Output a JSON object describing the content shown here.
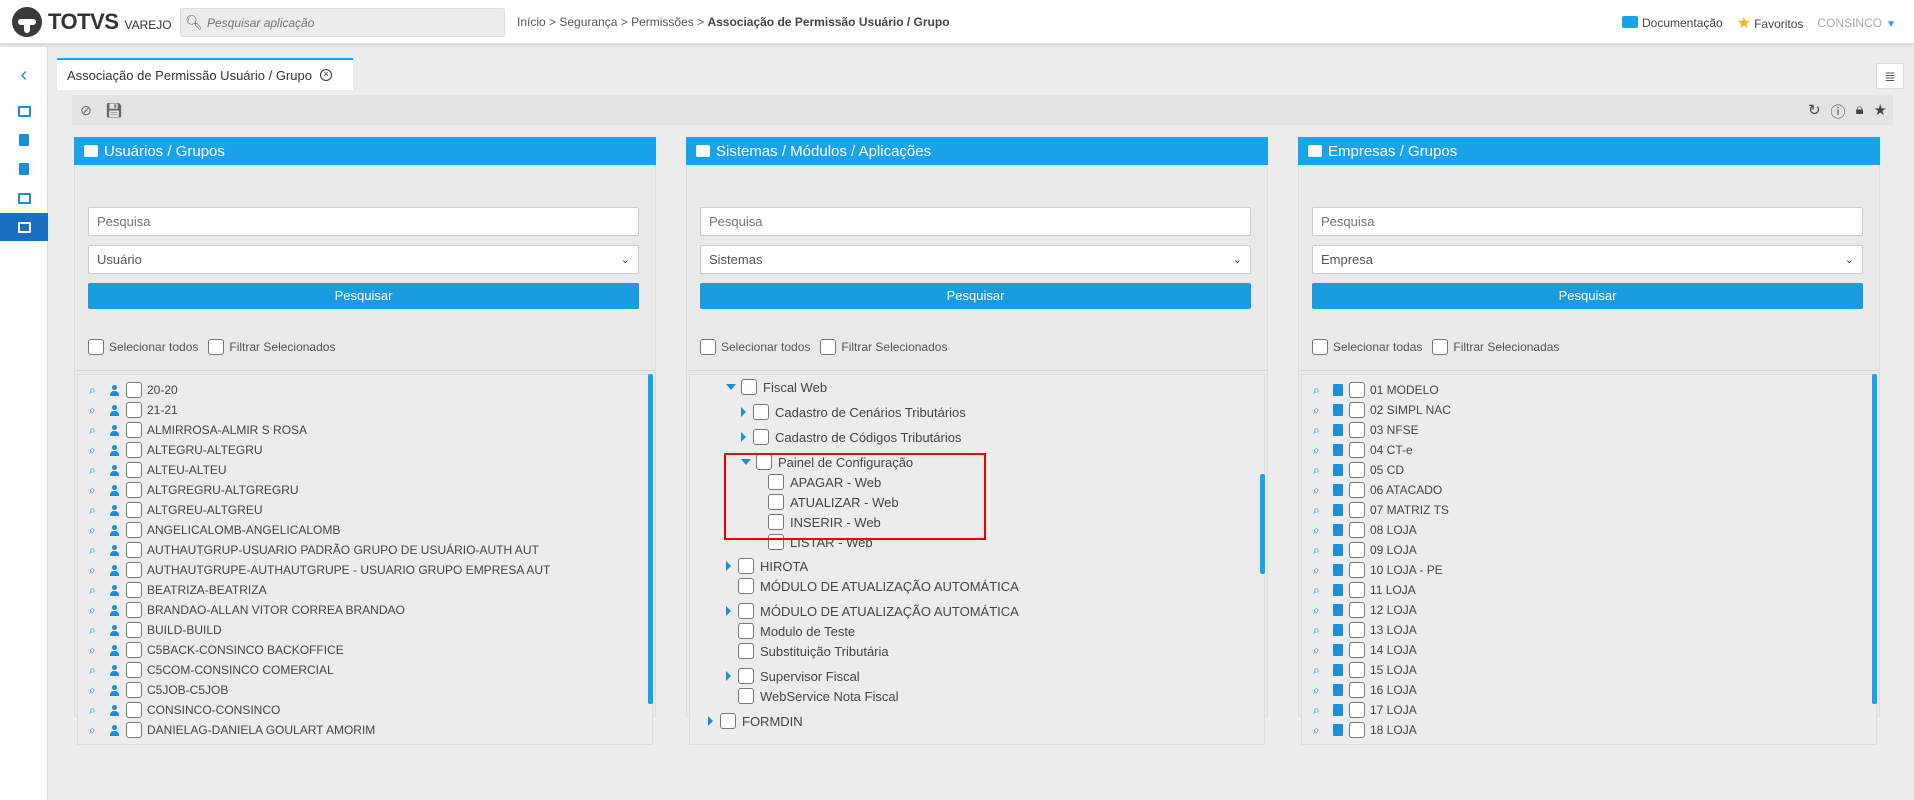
{
  "header": {
    "logo_text": "TOTVS",
    "logo_sub": "VAREJO",
    "search_placeholder": "Pesquisar aplicação",
    "breadcrumb_path": "Início > Segurança > Permissões > ",
    "breadcrumb_current": "Associação de Permissão Usuário / Grupo",
    "documentation_label": "Documentação",
    "favorites_label": "Favoritos",
    "user_label": "CONSINCO"
  },
  "tab": {
    "label": "Associação de Permissão Usuário / Grupo"
  },
  "panels": {
    "users": {
      "title": "Usuários / Grupos",
      "search_placeholder": "Pesquisa",
      "select_value": "Usuário",
      "search_button": "Pesquisar",
      "select_all": "Selecionar todos",
      "filter_selected": "Filtrar Selecionados",
      "items": [
        "20-20",
        "21-21",
        "ALMIRROSA-ALMIR S ROSA",
        "ALTEGRU-ALTEGRU",
        "ALTEU-ALTEU",
        "ALTGREGRU-ALTGREGRU",
        "ALTGREU-ALTGREU",
        "ANGELICALOMB-ANGELICALOMB",
        "AUTHAUTGRUP-USUARIO PADRÃO GRUPO DE USUÁRIO-AUTH AUT",
        "AUTHAUTGRUPE-AUTHAUTGRUPE - USUARIO GRUPO EMPRESA AUT",
        "BEATRIZA-BEATRIZA",
        "BRANDAO-ALLAN VITOR CORREA BRANDAO",
        "BUILD-BUILD",
        "C5BACK-CONSINCO BACKOFFICE",
        "C5COM-CONSINCO COMERCIAL",
        "C5JOB-C5JOB",
        "CONSINCO-CONSINCO",
        "DANIELAG-DANIELA GOULART AMORIM"
      ]
    },
    "systems": {
      "title": "Sistemas / Módulos / Aplicações",
      "search_placeholder": "Pesquisa",
      "select_value": "Sistemas",
      "search_button": "Pesquisar",
      "select_all": "Selecionar todos",
      "filter_selected": "Filtrar Selecionados",
      "tree": {
        "fiscal_web": "Fiscal Web",
        "cad_cenarios": "Cadastro de Cenários Tributários",
        "cad_codigos": "Cadastro de Códigos Tributários",
        "painel": "Painel de Configuração",
        "apagar": "APAGAR - Web",
        "atualizar": "ATUALIZAR - Web",
        "inserir": "INSERIR - Web",
        "listar": "LISTAR - Web",
        "hirota": "HIROTA",
        "modulo_atual_1": "MÓDULO DE ATUALIZAÇÃO AUTOMÁTICA",
        "modulo_atual_2": "MÓDULO DE ATUALIZAÇÃO AUTOMÁTICA",
        "modulo_teste": "Modulo de Teste",
        "substituicao": "Substituição Tributária",
        "supervisor": "Supervisor Fiscal",
        "webservice": "WebService Nota Fiscal",
        "formdin": "FORMDIN"
      }
    },
    "companies": {
      "title": "Empresas / Grupos",
      "search_placeholder": "Pesquisa",
      "select_value": "Empresa",
      "search_button": "Pesquisar",
      "select_all": "Selecionar todas",
      "filter_selected": "Filtrar Selecionadas",
      "items": [
        "01 MODELO",
        "02 SIMPL NAC",
        "03 NFSE",
        "04 CT-e",
        "05 CD",
        "06 ATACADO",
        "07 MATRIZ TS",
        "08 LOJA",
        "09 LOJA",
        "10 LOJA - PE",
        "11 LOJA",
        "12 LOJA",
        "13 LOJA",
        "14 LOJA",
        "15 LOJA",
        "16 LOJA",
        "17 LOJA",
        "18 LOJA"
      ]
    }
  },
  "colors": {
    "accent": "#1aa3e8",
    "highlight": "#e00000"
  }
}
